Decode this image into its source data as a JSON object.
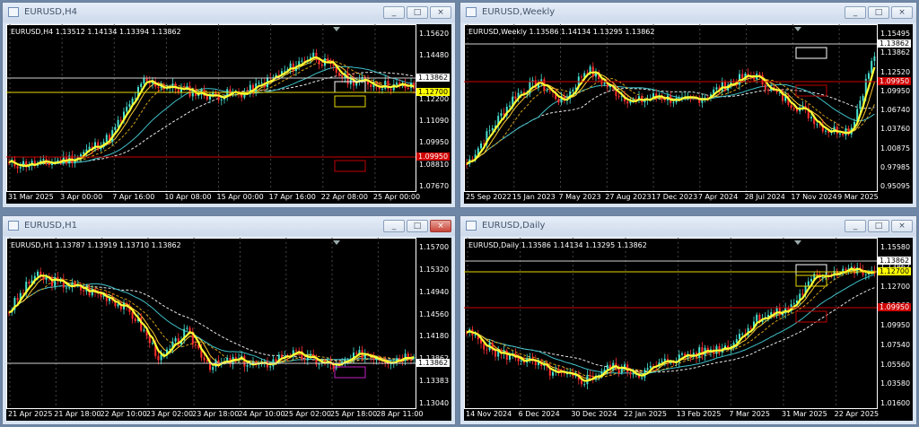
{
  "windows": [
    {
      "id": "h4",
      "title": "EURUSD,H4",
      "info": "EURUSD,H4  1.13512 1.14134 1.13394 1.13862",
      "price_labels": [
        "1.15620",
        "1.14480",
        "1.13383",
        "1.12200",
        "1.11090",
        "1.09950",
        "1.08810",
        "1.07670"
      ],
      "tags": {
        "current": "1.13862",
        "yellow": "1.12700",
        "red": "1.09950"
      },
      "time_labels": [
        "31 Mar 2025",
        "3 Apr 00:00",
        "7 Apr 16:00",
        "10 Apr 08:00",
        "15 Apr 00:00",
        "17 Apr 16:00",
        "22 Apr 08:00",
        "25 Apr 00:00"
      ],
      "seed": 11,
      "trend": [
        0.1,
        0.1,
        0.15,
        0.3,
        0.7,
        0.65,
        0.6,
        0.62,
        0.75,
        0.9,
        0.72,
        0.68,
        0.66
      ]
    },
    {
      "id": "weekly",
      "title": "EURUSD,Weekly",
      "info": "EURUSD,Weekly  1.13586 1.14134 1.13295 1.13862",
      "price_labels": [
        "1.15495",
        "1.13862",
        "1.12520",
        "1.09950",
        "1.06740",
        "1.03760",
        "1.00875",
        "0.97985",
        "0.95095"
      ],
      "tags": {
        "current": "1.13862",
        "red": "1.09950"
      },
      "time_labels": [
        "25 Sep 2022",
        "15 Jan 2023",
        "7 May 2023",
        "27 Aug 2023",
        "17 Dec 2023",
        "7 Apr 2024",
        "28 Jul 2024",
        "17 Nov 2024",
        "9 Mar 2025"
      ],
      "seed": 7,
      "trend": [
        0.1,
        0.35,
        0.6,
        0.7,
        0.55,
        0.8,
        0.65,
        0.55,
        0.6,
        0.55,
        0.6,
        0.7,
        0.75,
        0.6,
        0.5,
        0.35,
        0.35,
        0.9
      ]
    },
    {
      "id": "h1",
      "title": "EURUSD,H1",
      "info": "EURUSD,H1  1.13787 1.13919 1.13710 1.13862",
      "price_labels": [
        "1.15700",
        "1.15320",
        "1.14940",
        "1.14560",
        "1.14180",
        "1.13862",
        "1.13383",
        "1.13040"
      ],
      "tags": {
        "current": "1.13862"
      },
      "time_labels": [
        "21 Apr 2025",
        "21 Apr 18:00",
        "22 Apr 10:00",
        "23 Apr 02:00",
        "23 Apr 18:00",
        "24 Apr 10:00",
        "25 Apr 02:00",
        "25 Apr 18:00",
        "28 Apr 11:00"
      ],
      "seed": 3,
      "trend": [
        0.6,
        0.85,
        0.8,
        0.75,
        0.7,
        0.55,
        0.25,
        0.45,
        0.2,
        0.25,
        0.2,
        0.3,
        0.25,
        0.2,
        0.3,
        0.25,
        0.3
      ]
    },
    {
      "id": "daily",
      "title": "EURUSD,Daily",
      "info": "EURUSD,Daily  1.13586 1.14134 1.13295 1.13862",
      "price_labels": [
        "1.15580",
        "1.13862",
        "1.12700",
        "1.11560",
        "1.09950",
        "1.07540",
        "1.05560",
        "1.03580",
        "1.01600"
      ],
      "tags": {
        "current": "1.13862",
        "yellow": "1.12700",
        "red": "1.09950"
      },
      "time_labels": [
        "14 Nov 2024",
        "6 Dec 2024",
        "30 Dec 2024",
        "22 Jan 2025",
        "13 Feb 2025",
        "7 Mar 2025",
        "31 Mar 2025",
        "22 Apr 2025"
      ],
      "seed": 5,
      "trend": [
        0.45,
        0.3,
        0.25,
        0.15,
        0.1,
        0.2,
        0.15,
        0.25,
        0.3,
        0.35,
        0.55,
        0.6,
        0.85,
        0.9,
        0.85
      ]
    }
  ],
  "buttons": {
    "minimize": "_",
    "maximize": "□",
    "close": "×"
  }
}
